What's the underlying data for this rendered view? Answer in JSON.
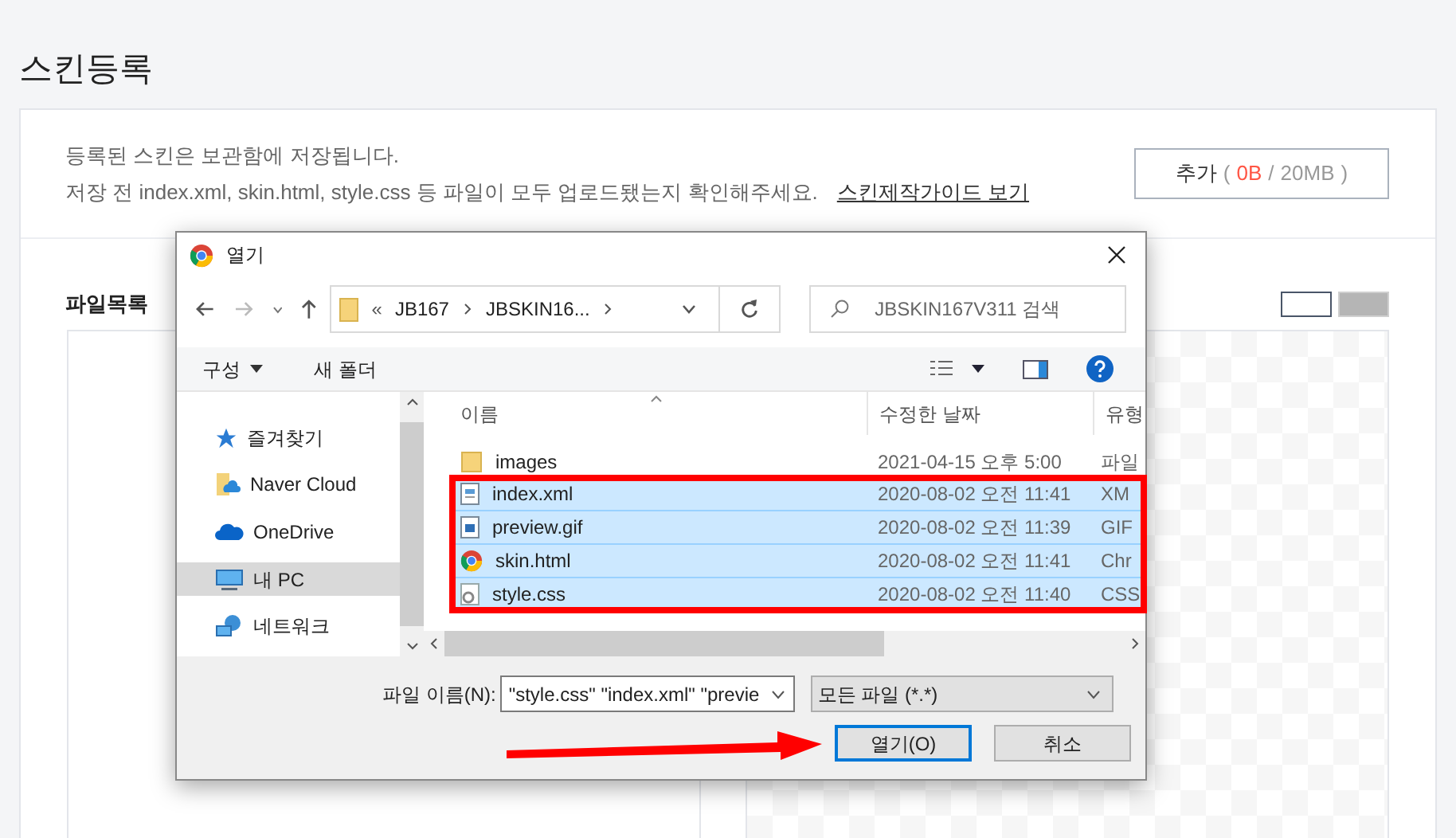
{
  "page": {
    "title": "스킨등록",
    "notice": [
      "등록된 스킨은 보관함에 저장됩니다.",
      "저장 전 index.xml, skin.html, style.css 등 파일이 모두 업로드됐는지 확인해주세요."
    ],
    "guide_link": "스킨제작가이드 보기",
    "add_button": {
      "label": "추가",
      "open_paren": "(",
      "used": "0B",
      "separator": "/",
      "limit": "20MB",
      "close_paren": ")"
    },
    "file_list_title": "파일목록",
    "bg_toggles": [
      {
        "kind": "light",
        "selected": true
      },
      {
        "kind": "dark",
        "selected": false
      }
    ]
  },
  "dialog": {
    "title": "열기",
    "breadcrumb": [
      "JB167",
      "JBSKIN16..."
    ],
    "breadcrumb_prefix": "«",
    "search": {
      "placeholder": "JBSKIN167V311 검색"
    },
    "organize": "구성",
    "new_folder": "새 폴더",
    "sidebar": [
      {
        "label": "즐겨찾기",
        "kind": "star",
        "selected": false
      },
      {
        "label": "Naver Cloud",
        "kind": "cloud-folder",
        "selected": false
      },
      {
        "label": "OneDrive",
        "kind": "cloud",
        "selected": false
      },
      {
        "label": "내 PC",
        "kind": "pc",
        "selected": true
      },
      {
        "label": "네트워크",
        "kind": "network",
        "selected": false
      }
    ],
    "columns": [
      "이름",
      "수정한 날짜",
      "유형"
    ],
    "files": [
      {
        "name": "images",
        "date": "2021-04-15 오후 5:00",
        "type": "파일",
        "kind": "folder",
        "selected": false
      },
      {
        "name": "index.xml",
        "date": "2020-08-02 오전 11:41",
        "type": "XM",
        "kind": "xml",
        "selected": true
      },
      {
        "name": "preview.gif",
        "date": "2020-08-02 오전 11:39",
        "type": "GIF",
        "kind": "image",
        "selected": true
      },
      {
        "name": "skin.html",
        "date": "2020-08-02 오전 11:41",
        "type": "Chr",
        "kind": "chrome",
        "selected": true
      },
      {
        "name": "style.css",
        "date": "2020-08-02 오전 11:40",
        "type": "CSS",
        "kind": "css",
        "selected": true
      }
    ],
    "filename_label": "파일 이름(N):",
    "filename_value": "\"style.css\" \"index.xml\" \"previe",
    "filter": "모든 파일 (*.*)",
    "open_button": "열기(O)",
    "cancel_button": "취소"
  }
}
